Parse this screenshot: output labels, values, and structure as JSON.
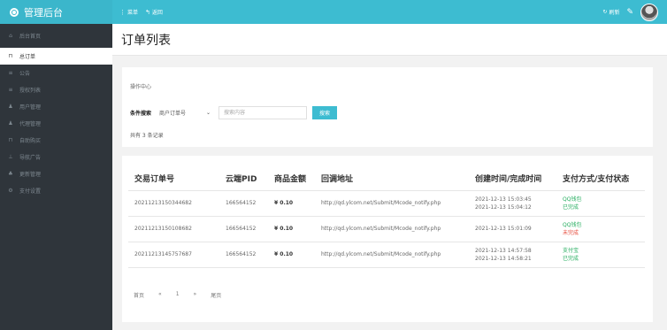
{
  "brand": {
    "title": "管理后台",
    "icon": "logo-icon"
  },
  "topnav": {
    "menu_label": "菜单",
    "back_label": "返回",
    "refresh_label": "刷新"
  },
  "sidebar": {
    "items": [
      {
        "label": "后台首页",
        "icon": "home-icon",
        "glyph": "⌂"
      },
      {
        "label": "总订单",
        "icon": "cart-icon",
        "glyph": "⊓"
      },
      {
        "label": "公告",
        "icon": "list-icon",
        "glyph": "≡"
      },
      {
        "label": "授权列表",
        "icon": "list-icon",
        "glyph": "≡"
      },
      {
        "label": "用户管理",
        "icon": "user-icon",
        "glyph": "♟"
      },
      {
        "label": "代理管理",
        "icon": "user-icon",
        "glyph": "♟"
      },
      {
        "label": "自助购买",
        "icon": "cart-icon",
        "glyph": "⊓"
      },
      {
        "label": "导航广告",
        "icon": "sitemap-icon",
        "glyph": "⊥"
      },
      {
        "label": "更新管理",
        "icon": "users-icon",
        "glyph": "♣"
      },
      {
        "label": "支付设置",
        "icon": "cog-icon",
        "glyph": "⚙"
      }
    ]
  },
  "page": {
    "title": "订单列表"
  },
  "ops": {
    "title": "操作中心",
    "search_label": "条件搜索",
    "select_value": "商户订单号",
    "search_placeholder": "搜索内容",
    "search_button": "搜索",
    "count_text": "共有 3 条记录"
  },
  "table": {
    "headers": [
      "交易订单号",
      "云端PID",
      "商品金额",
      "回调地址",
      "创建时间/完成时间",
      "支付方式/支付状态"
    ],
    "rows": [
      {
        "order": "20211213150344682",
        "pid": "166564152",
        "amount": "¥ 0.10",
        "callback": "http://qd.ylcom.net/Submit/Mcode_notify.php",
        "time1": "2021-12-13 15:03:45",
        "time2": "2021-12-13 15:04:12",
        "method": "QQ钱包",
        "status": "已完成",
        "status_class": "ok"
      },
      {
        "order": "20211213150108682",
        "pid": "166564152",
        "amount": "¥ 0.10",
        "callback": "http://qd.ylcom.net/Submit/Mcode_notify.php",
        "time1": "2021-12-13 15:01:09",
        "time2": "",
        "method": "QQ钱包",
        "status": "未完成",
        "status_class": "no"
      },
      {
        "order": "20211213145757687",
        "pid": "166564152",
        "amount": "¥ 0.10",
        "callback": "http://qd.ylcom.net/Submit/Mcode_notify.php",
        "time1": "2021-12-13 14:57:58",
        "time2": "2021-12-13 14:58:21",
        "method": "支付宝",
        "status": "已完成",
        "status_class": "ok"
      }
    ]
  },
  "pager": {
    "first": "首页",
    "prev": "«",
    "page": "1",
    "next": "»",
    "last": "尾页"
  },
  "colors": {
    "accent": "#3dbcd1",
    "sidebar": "#2f353b",
    "success": "#27ae60",
    "danger": "#e74c3c"
  }
}
